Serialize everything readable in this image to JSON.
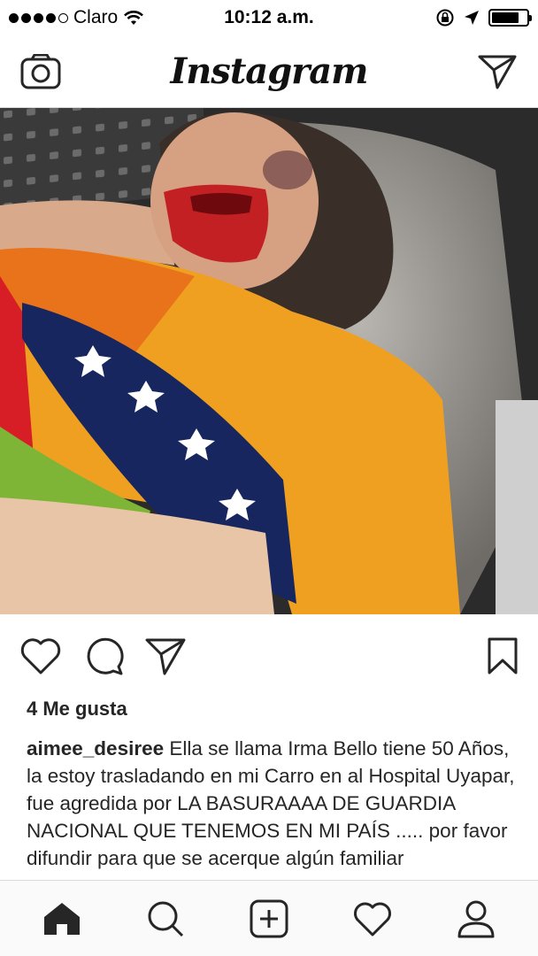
{
  "status_bar": {
    "carrier": "Claro",
    "time": "10:12 a.m.",
    "signal_bars_filled": 4,
    "signal_bars_total": 5,
    "battery_level": 0.8,
    "icons": [
      "wifi-icon",
      "rotation-lock-icon",
      "location-arrow-icon",
      "battery-icon"
    ]
  },
  "top_nav": {
    "logo": "Instagram",
    "left_icon": "camera-icon",
    "right_icon": "direct-message-icon"
  },
  "post": {
    "image_description_icon": "post-photo",
    "actions": [
      "heart-icon",
      "comment-icon",
      "share-icon",
      "bookmark-icon"
    ],
    "likes": "4 Me gusta",
    "caption_user": "aimee_desiree",
    "caption_text": "Ella se llama Irma Bello tiene 50 Años, la estoy trasladando en mi Carro en al Hospital Uyapar, fue agredida por LA BASURAAAA DE GUARDIA NACIONAL QUE TENEMOS EN MI PAÍS ..... por favor difundir para que se acerque algún familiar"
  },
  "tab_bar": {
    "tabs": [
      "home-icon",
      "search-icon",
      "new-post-icon",
      "activity-icon",
      "profile-icon"
    ],
    "active": "home-icon"
  },
  "colors": {
    "text": "#262626",
    "divider": "#dbdbdb",
    "tab_bg": "#fafafa"
  }
}
